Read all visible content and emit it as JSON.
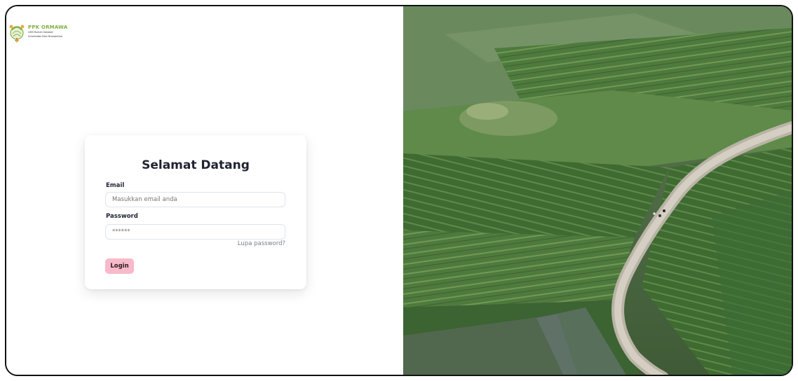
{
  "brand": {
    "title": "PPK ORMAWA",
    "sub_line1": "UKM Rumah Sahabat",
    "sub_line2": "Universitas Dian Nuswantoro",
    "logo_icon": "ppk-ormawa-logo"
  },
  "login": {
    "heading": "Selamat Datang",
    "email_label": "Email",
    "email_placeholder": "Masukkan email anda",
    "password_label": "Password",
    "password_placeholder": "******",
    "forgot_link": "Lupa password?",
    "login_button": "Login"
  },
  "colors": {
    "login_button": "#f8b9c9",
    "brand_green": "#7fb043"
  },
  "hero_image": {
    "subject": "aerial view of rice terraces with a winding road"
  }
}
